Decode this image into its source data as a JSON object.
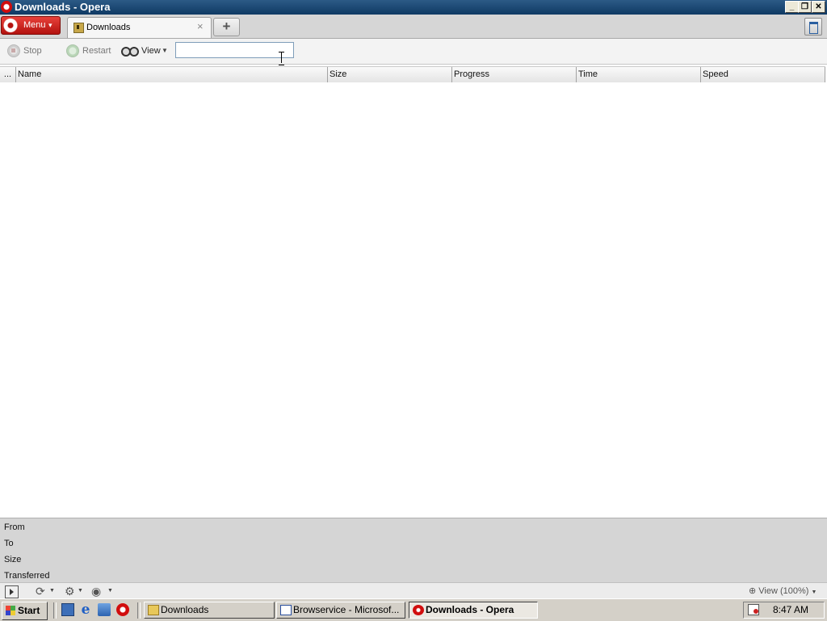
{
  "window": {
    "title": "Downloads - Opera",
    "controls": [
      "minimize",
      "restore",
      "close"
    ]
  },
  "tabstrip": {
    "menu_label": "Menu",
    "tabs": [
      {
        "label": "Downloads",
        "icon": "downloads-icon",
        "active": true
      }
    ],
    "new_tab_symbol": "+",
    "close_symbol": "×",
    "trash_icon": "trash-icon"
  },
  "toolbar": {
    "stop_label": "Stop",
    "restart_label": "Restart",
    "view_label": "View",
    "search_value": ""
  },
  "columns": {
    "more": "...",
    "name": "Name",
    "size": "Size",
    "progress": "Progress",
    "time": "Time",
    "speed": "Speed"
  },
  "details": {
    "from_label": "From",
    "to_label": "To",
    "size_label": "Size",
    "transferred_label": "Transferred"
  },
  "statusbar": {
    "zoom_label": "View (100%)"
  },
  "taskbar": {
    "start_label": "Start",
    "tasks": [
      {
        "label": "Downloads",
        "active": false
      },
      {
        "label": "Browservice - Microsof...",
        "active": false
      },
      {
        "label": "Downloads - Opera",
        "active": true
      }
    ],
    "clock": "8:47 AM"
  },
  "colors": {
    "titlebar": "#0f3a64",
    "opera_red": "#d10d0d",
    "taskbar": "#d4d0c8",
    "details_panel": "#d5d5d5"
  }
}
